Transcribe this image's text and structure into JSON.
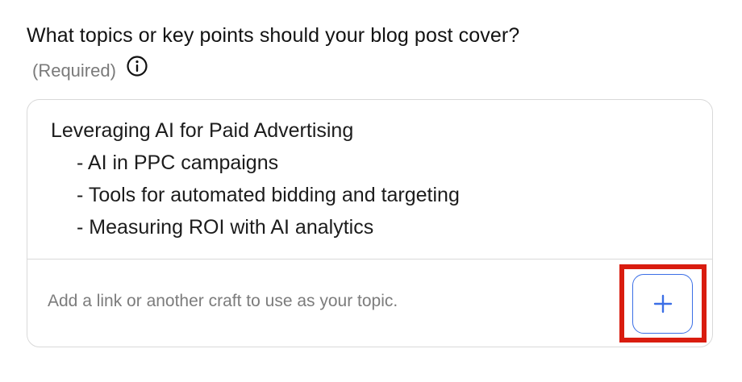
{
  "form": {
    "question": "What topics or key points should your blog post cover?",
    "required_label": "(Required)",
    "info_icon": "info-icon"
  },
  "topic_box": {
    "lines": [
      "Leveraging AI for Paid Advertising",
      "- AI in PPC campaigns",
      "- Tools for automated bidding and targeting",
      "- Measuring ROI with AI analytics"
    ]
  },
  "footer": {
    "hint": "Add a link or another craft to use as your topic.",
    "add_button_icon": "plus-icon"
  },
  "colors": {
    "accent": "#3b6fe6",
    "highlight": "#d91c0f",
    "border": "#d9d9d9"
  }
}
